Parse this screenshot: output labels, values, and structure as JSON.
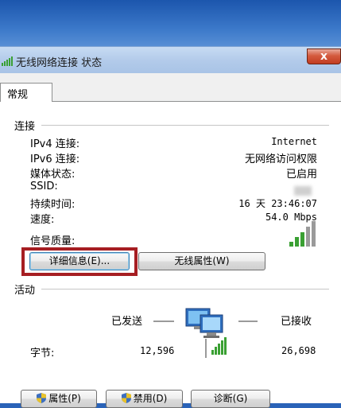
{
  "window": {
    "title": "无线网络连接 状态",
    "close_label": "x"
  },
  "tabs": [
    {
      "label": "常规"
    }
  ],
  "connection": {
    "section_title": "连接",
    "rows": [
      {
        "label": "IPv4 连接:",
        "value": "Internet"
      },
      {
        "label": "IPv6 连接:",
        "value": "无网络访问权限"
      },
      {
        "label": "媒体状态:",
        "value": "已启用"
      },
      {
        "label": "SSID:",
        "value": ""
      },
      {
        "label": "持续时间:",
        "value": "16 天 23:46:07"
      },
      {
        "label": "速度:",
        "value": "54.0 Mbps"
      }
    ],
    "signal_label": "信号质量:",
    "signal_bars": 5
  },
  "buttons": {
    "details": "详细信息(E)...",
    "wireless_props": "无线属性(W)"
  },
  "activity": {
    "section_title": "活动",
    "sent_label": "已发送",
    "received_label": "已接收",
    "bytes_label": "字节:",
    "bytes_sent": "12,596",
    "bytes_received": "26,698"
  },
  "bottom_buttons": {
    "properties": "属性(P)",
    "disable": "禁用(D)",
    "diagnose": "诊断(G)"
  },
  "colors": {
    "highlight": "#a61e22",
    "signal_green": "#3aa033",
    "titlebar": "#b3cbea"
  }
}
